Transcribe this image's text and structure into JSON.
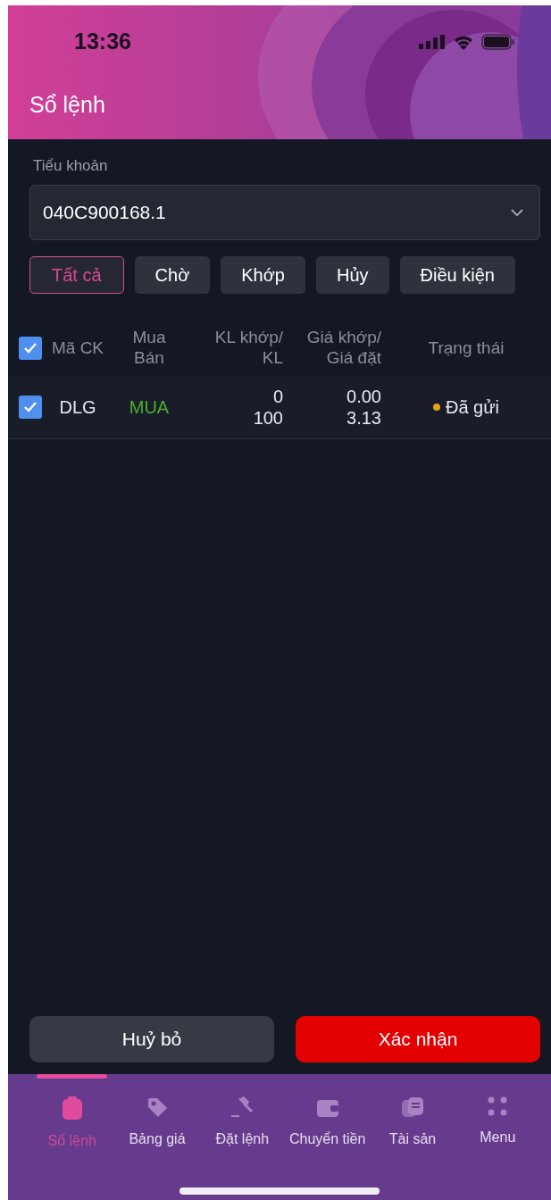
{
  "status_bar": {
    "time": "13:36"
  },
  "header": {
    "title": "Sổ lệnh"
  },
  "account": {
    "label": "Tiểu khoản",
    "value": "040C900168.1"
  },
  "filters": [
    {
      "label": "Tất cả",
      "selected": true
    },
    {
      "label": "Chờ",
      "selected": false
    },
    {
      "label": "Khớp",
      "selected": false
    },
    {
      "label": "Hủy",
      "selected": false
    },
    {
      "label": "Điều kiện",
      "selected": false
    }
  ],
  "table": {
    "select_all": {
      "checked": true
    },
    "columns": [
      [
        "Mã CK"
      ],
      [
        "Mua",
        "Bán"
      ],
      [
        "KL khớp/",
        "KL"
      ],
      [
        "Giá khớp/",
        "Giá đặt"
      ],
      [
        "Trạng thái"
      ]
    ],
    "rows": [
      {
        "checked": true,
        "symbol": "DLG",
        "side": "MUA",
        "kind": "buy",
        "matched_qty": "0",
        "qty": "100",
        "matched_price": "0.00",
        "order_price": "3.13",
        "status": "Đã gửi",
        "color": "#e8a317"
      }
    ]
  },
  "actions": {
    "cancel": "Huỷ bỏ",
    "confirm": "Xác nhận"
  },
  "nav": [
    {
      "label": "Sổ lệnh",
      "kind": "clipboard",
      "selected": true
    },
    {
      "label": "Bảng giá",
      "kind": "tag",
      "selected": false
    },
    {
      "label": "Đặt lệnh",
      "kind": "gavel",
      "selected": false
    },
    {
      "label": "Chuyển tiền",
      "kind": "wallet",
      "selected": false
    },
    {
      "label": "Tài sản",
      "kind": "cards",
      "selected": false
    },
    {
      "label": "Menu",
      "kind": "dots",
      "selected": false
    }
  ]
}
